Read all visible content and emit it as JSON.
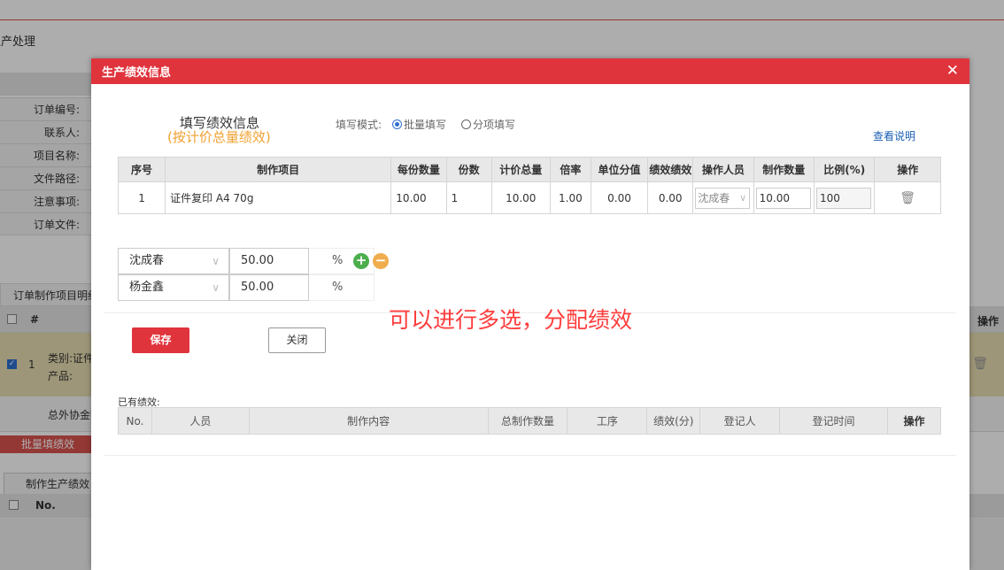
{
  "background": {
    "page_title": "生产处理",
    "form_labels": [
      "订单编号:",
      "联系人:",
      "项目名称:",
      "文件路径:",
      "注意事项:",
      "订单文件:"
    ],
    "section_title": "订单制作项目明细",
    "table_header": {
      "hash": "#",
      "operation": "操作"
    },
    "selected_row": {
      "index": "1",
      "line1": "类别:证件",
      "line2": "产品:"
    },
    "summary_text": "总外协金额",
    "batch_button": "批量填绩效",
    "tab_label": "制作生产绩效",
    "table2_header_no": "No."
  },
  "modal": {
    "title": "生产绩效信息",
    "close_glyph": "✕",
    "fill_title": "填写绩效信息",
    "fill_subtitle": "(按计价总量绩效)",
    "mode_label": "填写模式:",
    "mode_options": [
      "批量填写",
      "分项填写"
    ],
    "mode_selected": "批量填写",
    "help_link": "查看说明",
    "main_table": {
      "headers": [
        "序号",
        "制作项目",
        "每份数量",
        "份数",
        "计价总量",
        "倍率",
        "单位分值",
        "绩效绩效",
        "操作人员",
        "制作数量",
        "比例(%)",
        "操作"
      ],
      "row": {
        "index": "1",
        "item": "证件复印 A4 70g",
        "qty_per": "10.00",
        "copies": "1",
        "total": "10.00",
        "rate": "1.00",
        "unit_score": "0.00",
        "perf": "0.00",
        "operator": "沈成春",
        "make_qty": "10.00",
        "ratio": "100"
      }
    },
    "allocations": [
      {
        "person": "沈成春",
        "percent": "50.00",
        "unit": "%"
      },
      {
        "person": "杨金鑫",
        "percent": "50.00",
        "unit": "%"
      }
    ],
    "annotation": "可以进行多选，分配绩效",
    "save_button": "保存",
    "close_button": "关闭",
    "existing_label": "已有绩效:",
    "existing_table": {
      "headers": [
        "No.",
        "人员",
        "制作内容",
        "总制作数量",
        "工序",
        "绩效(分)",
        "登记人",
        "登记时间",
        "操作"
      ]
    }
  },
  "colors": {
    "accent": "#e0343d",
    "annotation": "#ff3d3d",
    "subtitle": "#f0a030",
    "link": "#1a5fb4"
  }
}
